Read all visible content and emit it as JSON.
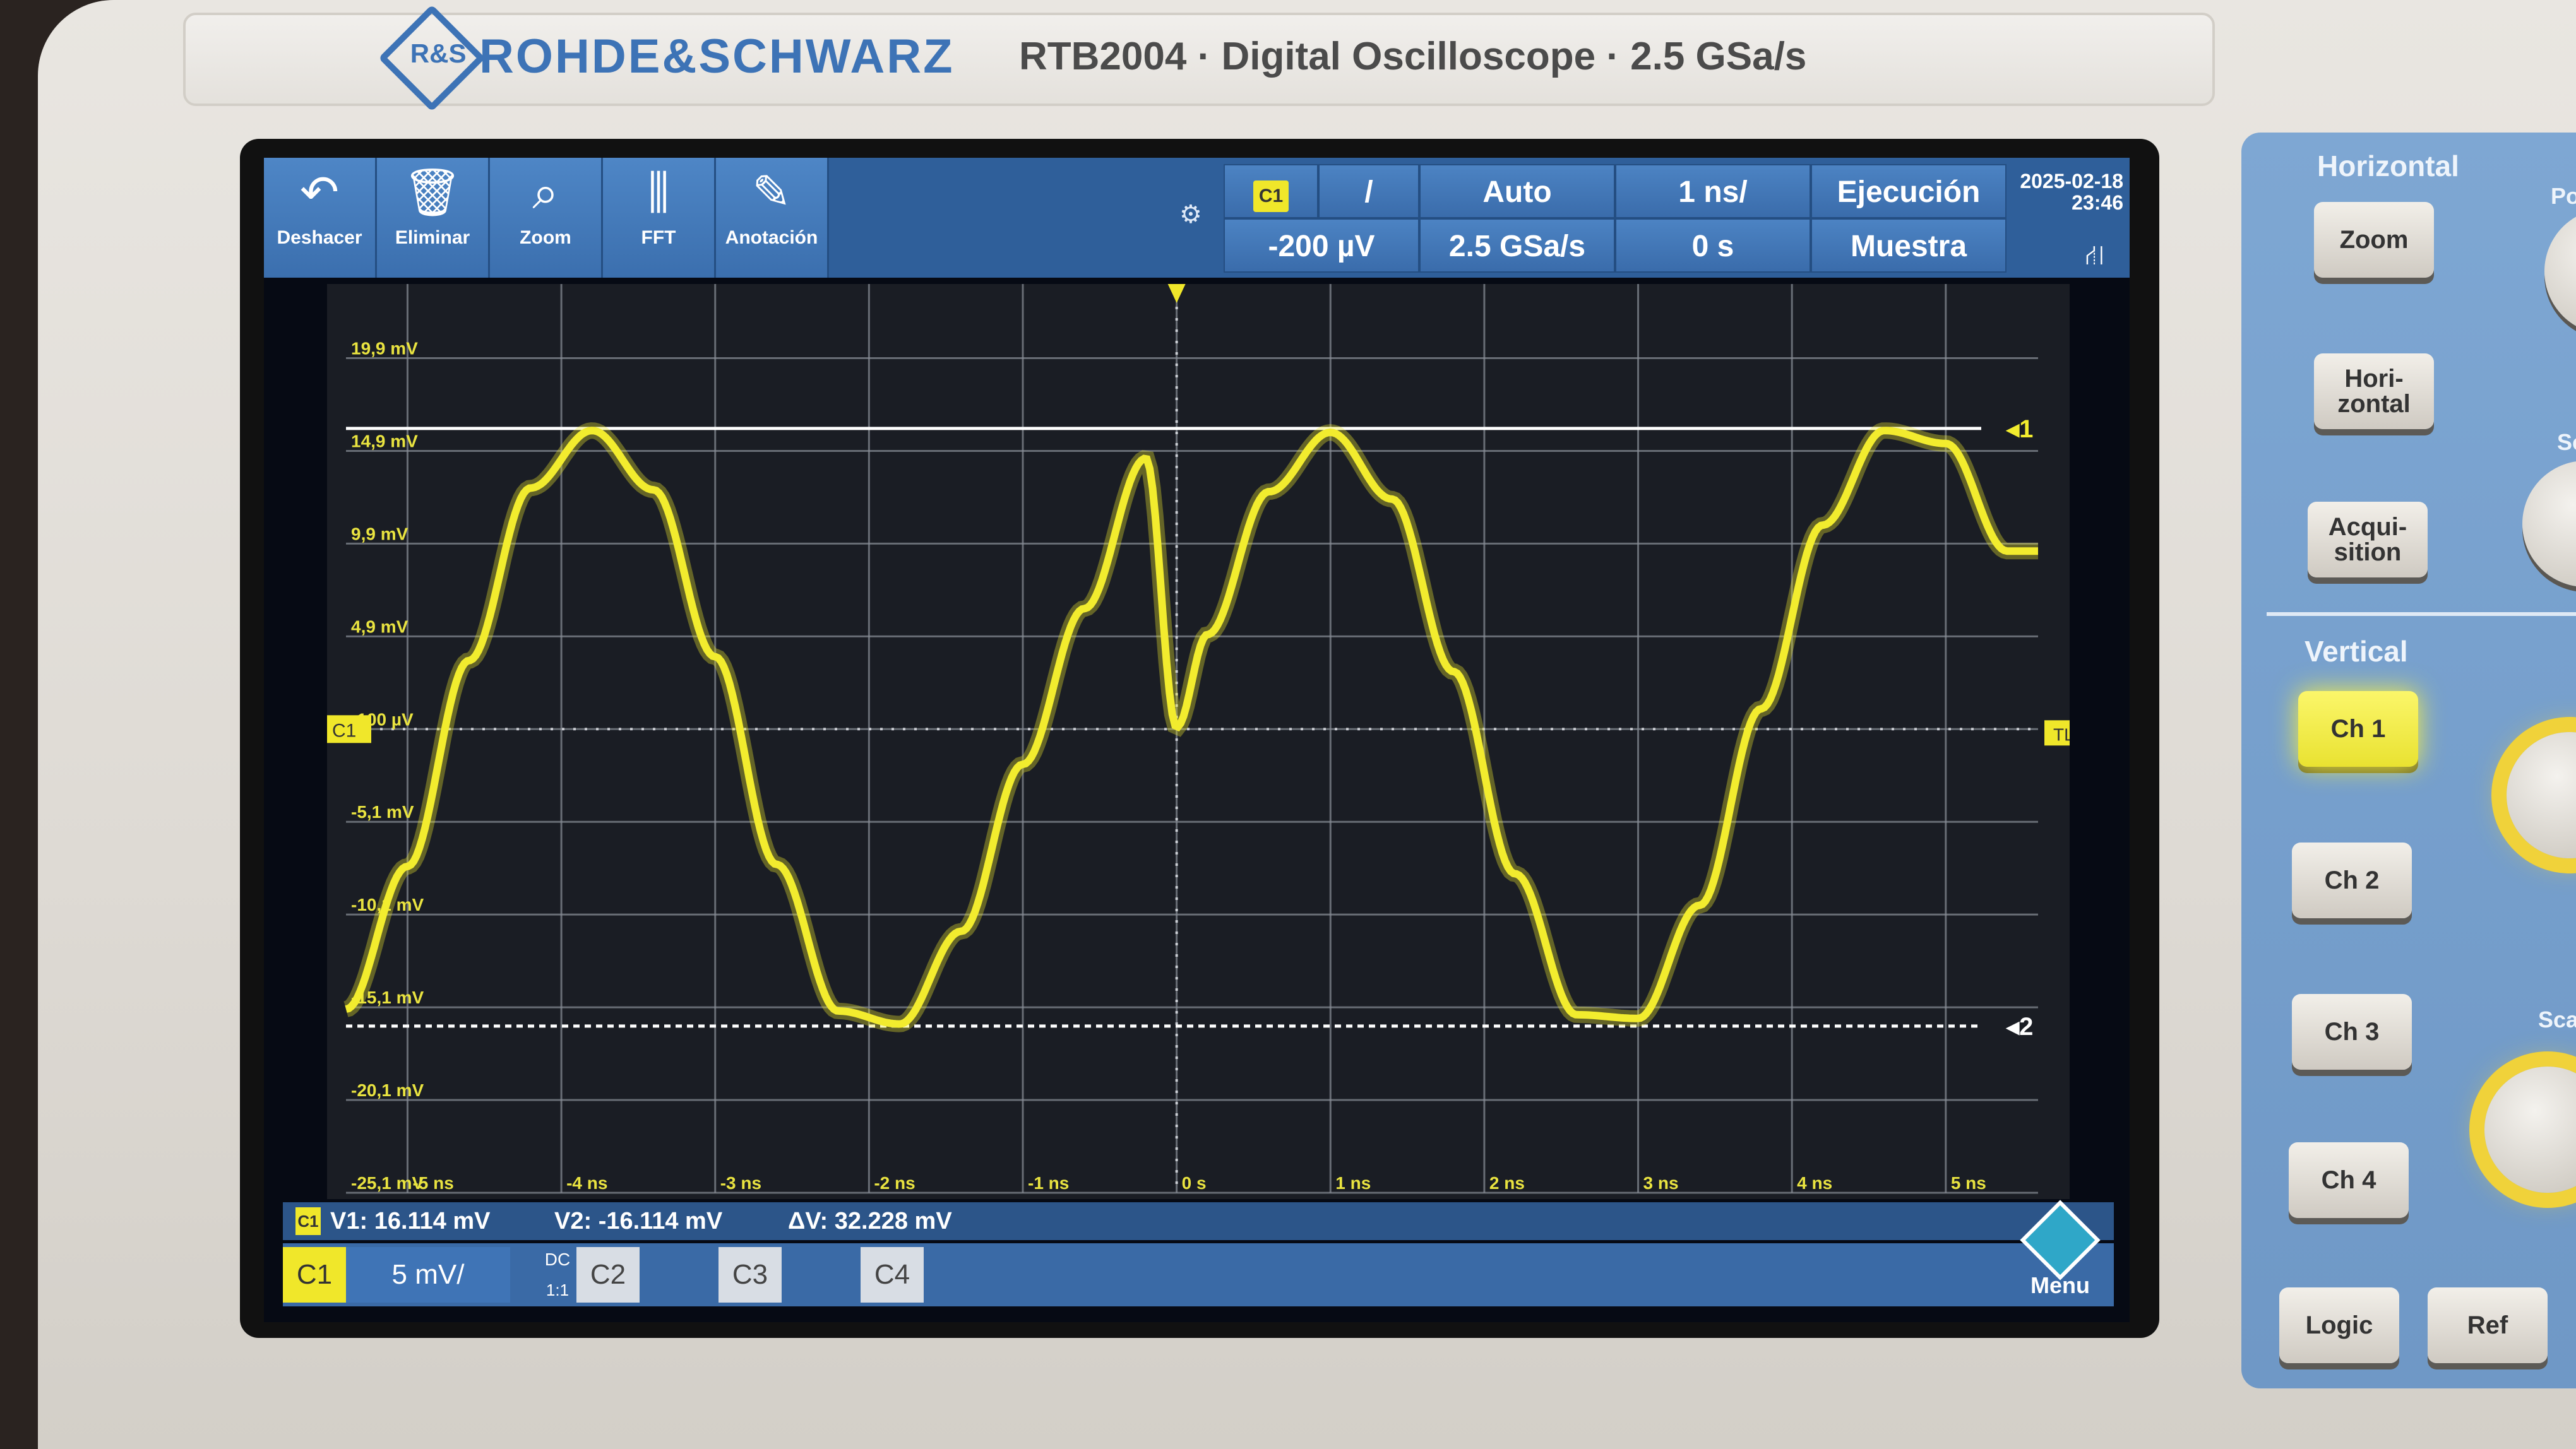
{
  "header": {
    "brand": "ROHDE&SCHWARZ",
    "logo_mark": "R&S",
    "model": "RTB2004 · Digital Oscilloscope · 2.5 GSa/s"
  },
  "toolbar": {
    "buttons": [
      {
        "label": "Deshacer",
        "icon": "undo-icon",
        "glyph": "↶"
      },
      {
        "label": "Eliminar",
        "icon": "trash-icon",
        "glyph": "🗑"
      },
      {
        "label": "Zoom",
        "icon": "zoom-icon",
        "glyph": "⌕"
      },
      {
        "label": "FFT",
        "icon": "fft-icon",
        "glyph": "⫼"
      },
      {
        "label": "Anotación",
        "icon": "pencil-icon",
        "glyph": "✎"
      }
    ],
    "trigger_source": "C1",
    "trigger_slope": "/",
    "trigger_mode": "Auto",
    "timebase": "1 ns/",
    "run_state": "Ejecución",
    "trigger_level": "-200 µV",
    "sample_rate": "2.5 GSa/s",
    "time_offset": "0 s",
    "acq_mode": "Muestra",
    "date": "2025-02-18",
    "time": "23:46"
  },
  "graticule": {
    "y_labels": [
      "19,9 mV",
      "14,9 mV",
      "9,9 mV",
      "4,9 mV",
      "-100 µV",
      "-5,1 mV",
      "-10,1 mV",
      "-15,1 mV",
      "-20,1 mV",
      "-25,1 mV"
    ],
    "x_labels": [
      "-5 ns",
      "-4 ns",
      "-3 ns",
      "-2 ns",
      "-1 ns",
      "0 s",
      "1 ns",
      "2 ns",
      "3 ns",
      "4 ns",
      "5 ns"
    ],
    "channel_marker": "C1",
    "trigger_level_marker": "TL",
    "cursor1_label": "1",
    "cursor2_label": "2",
    "trace_color": "#f2ec2e"
  },
  "chart_data": {
    "type": "line",
    "xlabel": "",
    "ylabel": "",
    "xlim": [
      -5.4,
      5.6
    ],
    "ylim": [
      -25.1,
      23.9
    ],
    "series": [
      {
        "x": [
          -5.4,
          -5.0,
          -4.6,
          -4.2,
          -3.8,
          -3.4,
          -3.0,
          -2.6,
          -2.2,
          -1.8,
          -1.4,
          -1.0,
          -0.6,
          -0.2,
          0.0,
          0.2,
          0.6,
          1.0,
          1.4,
          1.8,
          2.2,
          2.6,
          3.0,
          3.4,
          3.8,
          4.2,
          4.6,
          5.0,
          5.4
        ],
        "y": [
          -15.2,
          -7.5,
          3.6,
          12.9,
          16.0,
          12.8,
          3.8,
          -7.4,
          -15.3,
          -16.0,
          -11.0,
          -2.0,
          6.4,
          14.5,
          0.0,
          5.0,
          12.7,
          15.9,
          12.3,
          3.0,
          -7.9,
          -15.5,
          -15.7,
          -9.6,
          1.0,
          10.9,
          16.0,
          15.3,
          9.5
        ]
      }
    ]
  },
  "cursors": {
    "v1": "V1: 16.114 mV",
    "v2": "V2: -16.114 mV",
    "dv": "ΔV: 32.228 mV"
  },
  "channel_bar": {
    "c1": "C1",
    "scale": "5 mV/",
    "coupling": "DC",
    "probe": "1:1",
    "c2": "C2",
    "c3": "C3",
    "c4": "C4",
    "menu": "Menu"
  },
  "panel": {
    "horizontal_title": "Horizontal",
    "zoom": "Zoom",
    "horizontal": "Hori-\nzontal",
    "acquisition": "Acqui-\nsition",
    "vertical_title": "Vertical",
    "ch1": "Ch 1",
    "ch2": "Ch 2",
    "ch3": "Ch 3",
    "ch4": "Ch 4",
    "logic": "Logic",
    "ref": "Ref",
    "pos_partial": "Po",
    "scale_partial": "Sc",
    "scale2_partial": "Scal"
  }
}
